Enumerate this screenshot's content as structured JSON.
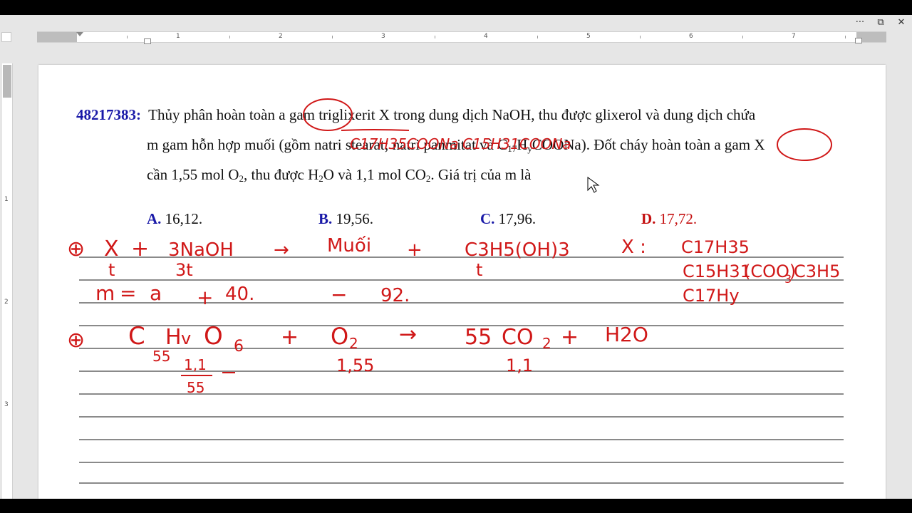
{
  "window": {
    "controls": [
      "···",
      "⧉",
      "✕"
    ]
  },
  "ruler": {
    "horizontal_numbers": [
      "1",
      "2",
      "3",
      "4",
      "5",
      "6",
      "7"
    ],
    "vertical_numbers": [
      "1",
      "2",
      "3"
    ]
  },
  "question": {
    "id": "48217383:",
    "line1": "Thủy phân hoàn toàn a gam triglixerit X trong dung dịch NaOH, thu được glixerol và dung dịch chứa",
    "line2_a": "m gam hỗn hợp muối (gồm natri stearat; natri panmitat và C",
    "line2_sub1": "17",
    "line2_b": "H",
    "line2_sub2": "y",
    "line2_c": "COONa). Đốt cháy hoàn toàn a gam X",
    "line3_a": "cần 1,55 mol O",
    "line3_sub1": "2",
    "line3_b": ", thu được H",
    "line3_sub2": "2",
    "line3_c": "O và 1,1 mol CO",
    "line3_sub3": "2",
    "line3_d": ". Giá trị của m là"
  },
  "options": [
    {
      "letter": "A.",
      "value": "16,12.",
      "color": "#1a1aa8"
    },
    {
      "letter": "B.",
      "value": "19,56.",
      "color": "#1a1aa8"
    },
    {
      "letter": "C.",
      "value": "17,96.",
      "color": "#1a1aa8"
    },
    {
      "letter": "D.",
      "value": "17,72.",
      "color": "#c41010"
    }
  ],
  "handwriting": {
    "ink_color": "#d01818",
    "annot1": "C17H35COONa",
    "annot2": "C15H31COONa",
    "row1": [
      "⊕",
      "X",
      "+",
      "3NaOH",
      "→",
      "Muối",
      "+",
      "C3H5(OH)3",
      "X :",
      "C17H35"
    ],
    "row1_under": [
      "t",
      "3t",
      "t"
    ],
    "row1_right": [
      "C15H31",
      "(COO)",
      "3",
      "C3H5",
      "C17Hy"
    ],
    "row2": [
      "m",
      "=",
      "a",
      "+",
      "40.",
      "−",
      "92."
    ],
    "row3": [
      "⊕",
      "C",
      "H",
      "v",
      "O",
      "6",
      "+",
      "O",
      "2",
      "→",
      "55",
      "CO",
      "2",
      "+",
      "H2O"
    ],
    "row3_sub": [
      "55",
      "1,55",
      "1,1"
    ],
    "row3_fraction": [
      "1,1",
      "55"
    ]
  },
  "colors": {
    "question_id": "#1a1aa8",
    "option_abc": "#1a1aa8",
    "option_d": "#c41010",
    "ink": "#d01818"
  }
}
